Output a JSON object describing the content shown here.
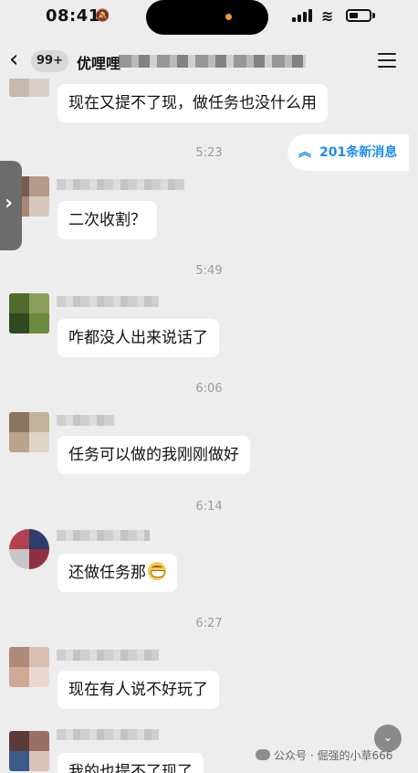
{
  "status_bar": {
    "time": "08:41",
    "bell_icon": "bell-muted-icon",
    "signal_icon": "cellular-signal-icon",
    "wifi_icon": "wifi-icon",
    "battery_icon": "battery-icon",
    "battery_level": 0.45,
    "island_indicator_color": "#f29a2e"
  },
  "nav": {
    "back_icon": "chevron-left-icon",
    "unread_count": "99+",
    "title": "优哩哩",
    "menu_icon": "hamburger-menu-icon"
  },
  "new_messages": {
    "icon": "double-chevron-up-icon",
    "label": "201条新消息",
    "color": "#1e8cf0"
  },
  "side_handle_icon": "chevron-right-icon",
  "messages": [
    {
      "text": "现在又提不了现，做任务也没什么用"
    },
    {
      "time": "5:23",
      "text": "二次收割？"
    },
    {
      "time": "5:49",
      "text": "咋都没人出来说话了"
    },
    {
      "time": "6:06",
      "text": "任务可以做的我刚刚做好"
    },
    {
      "time": "6:14",
      "text": "还做任务那",
      "emoji": "grinning-face-emoji"
    },
    {
      "time": "6:27",
      "text": "现在有人说不好玩了"
    },
    {
      "text": "我的也提不了现了"
    }
  ],
  "scroll_down_icon": "chevron-down-icon",
  "watermark": "公众号 · 倔强的小草666",
  "colors": {
    "background": "#ededed",
    "bubble": "#ffffff",
    "timestamp": "#9b9b9b"
  }
}
